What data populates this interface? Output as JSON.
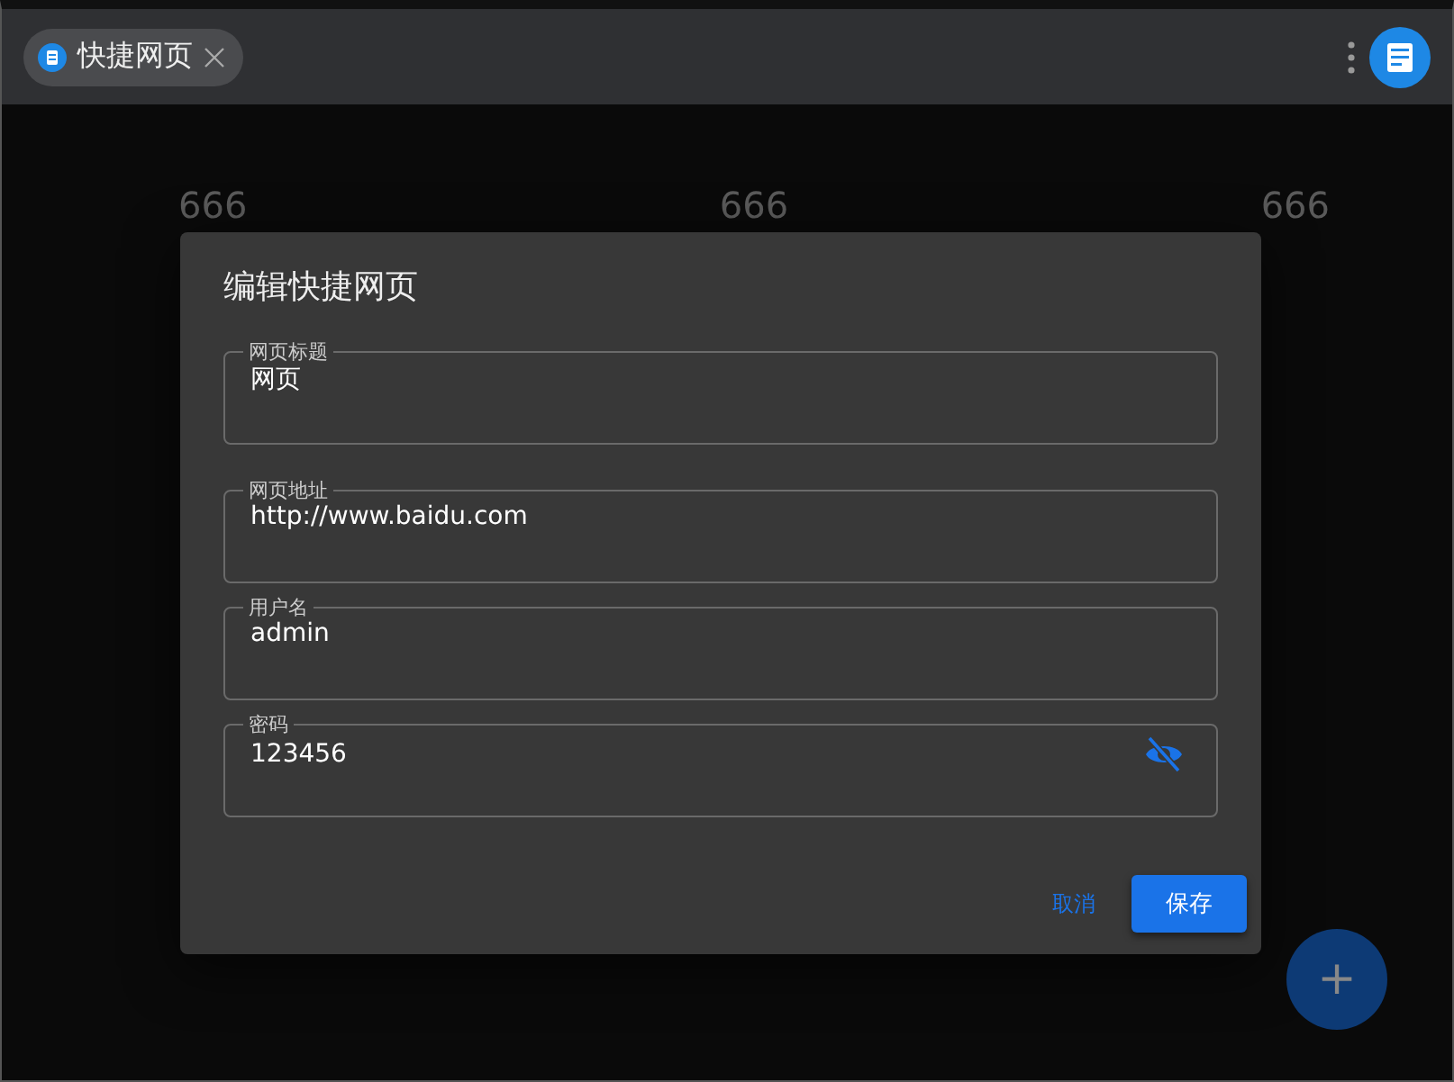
{
  "tab": {
    "label": "快捷网页",
    "selected": true
  },
  "background_cells": [
    "666",
    "666",
    "666"
  ],
  "dialog": {
    "title": "编辑快捷网页",
    "fields": [
      {
        "label": "网页标题",
        "value": "网页",
        "kind": "text"
      },
      {
        "label": "网页地址",
        "value": "http://www.baidu.com",
        "kind": "text"
      },
      {
        "label": "用户名",
        "value": "admin",
        "kind": "text"
      },
      {
        "label": "密码",
        "value": "123456",
        "kind": "password"
      }
    ],
    "cancel": "取消",
    "save": "保存"
  },
  "fab": "+"
}
